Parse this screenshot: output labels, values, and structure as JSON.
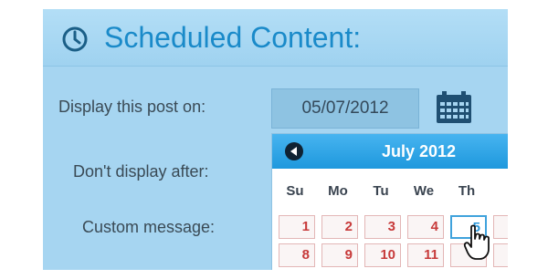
{
  "panel": {
    "title": "Scheduled Content:",
    "icon": "clock-icon"
  },
  "form": {
    "display_on_label": "Display this post on:",
    "display_on_value": "05/07/2012",
    "dont_display_after_label": "Don't display after:",
    "custom_message_label": "Custom message:"
  },
  "calendar": {
    "month_label": "July 2012",
    "weekdays": [
      "Su",
      "Mo",
      "Tu",
      "We",
      "Th"
    ],
    "week1": [
      "1",
      "2",
      "3",
      "4",
      "5"
    ],
    "week2": [
      "8",
      "9",
      "10",
      "11",
      ""
    ],
    "highlighted_day": "5"
  },
  "colors": {
    "panel_bg": "#a6d5f1",
    "title": "#1a8ac9",
    "calendar_header": "#1e98dd",
    "day_text": "#c73a3a",
    "today_border": "#3fa2dc"
  }
}
